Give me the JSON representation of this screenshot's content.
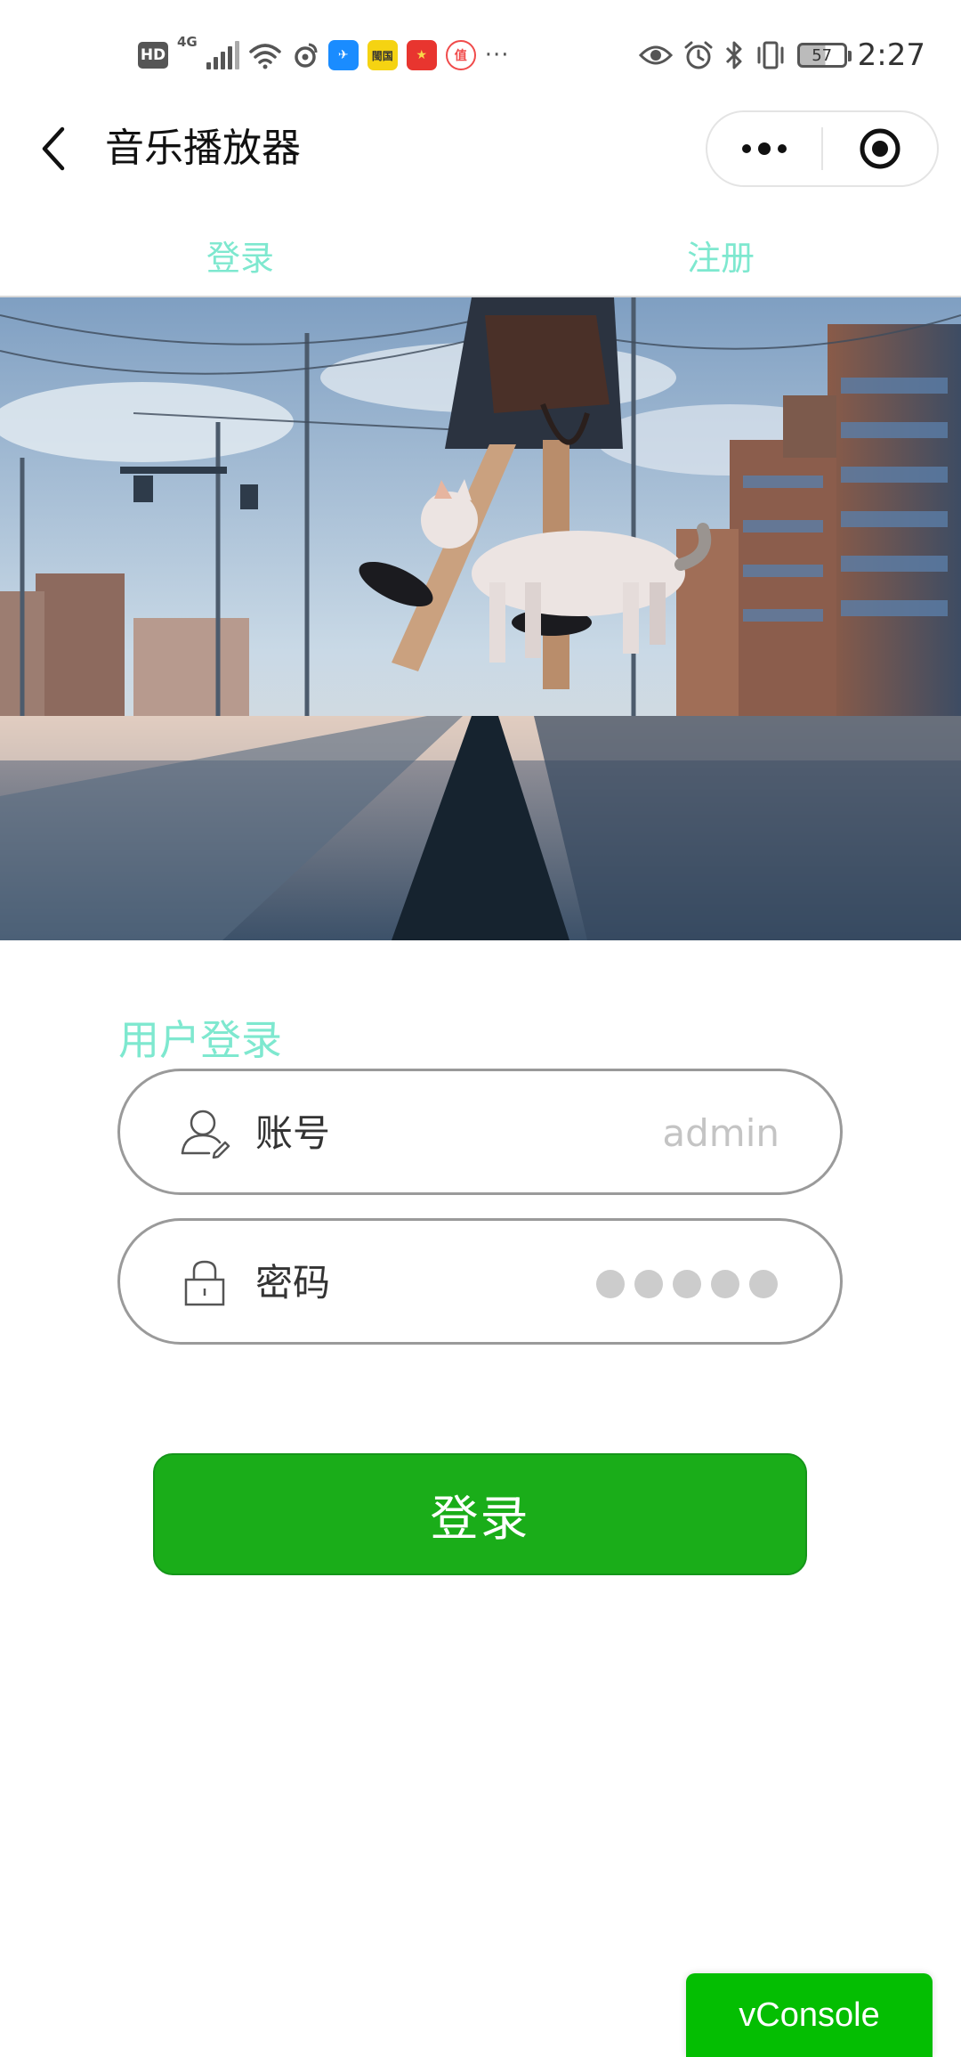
{
  "status_bar": {
    "hd_badge": "HD",
    "network": "4G",
    "app_icons": [
      {
        "name": "dingtalk-icon",
        "color": "#1a8cff",
        "text": "✈"
      },
      {
        "name": "app-yellow-icon",
        "color": "#f5d312",
        "text": "閩国"
      },
      {
        "name": "app-red-icon",
        "color": "#e8352f",
        "text": "★"
      },
      {
        "name": "app-pink-icon",
        "color": "#f04b4b",
        "text": "值"
      }
    ],
    "more": "···",
    "battery": "57",
    "time": "2:27"
  },
  "nav": {
    "title": "音乐播放器"
  },
  "tabs": [
    {
      "label": "登录"
    },
    {
      "label": "注册"
    }
  ],
  "form": {
    "title": "用户登录",
    "account": {
      "label": "账号",
      "value": "admin"
    },
    "password": {
      "label": "密码",
      "masked_length": 5
    },
    "submit": "登录"
  },
  "vconsole": {
    "label": "vConsole"
  },
  "colors": {
    "accent": "#7ee8cf",
    "button": "#1aad19",
    "vconsole": "#04be02"
  }
}
